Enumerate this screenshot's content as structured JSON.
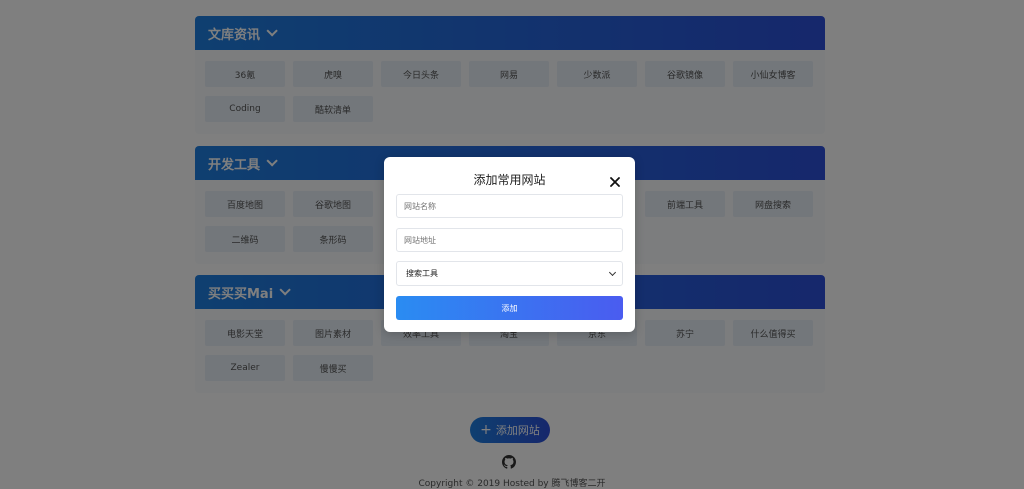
{
  "sections": [
    {
      "title": "文库资讯",
      "items": [
        "36氪",
        "虎嗅",
        "今日头条",
        "网易",
        "少数派",
        "谷歌镜像",
        "小仙女博客",
        "Coding",
        "酷软清单"
      ]
    },
    {
      "title": "开发工具",
      "items": [
        "百度地图",
        "谷歌地图",
        "",
        "",
        "",
        "前端工具",
        "网盘搜索",
        "二维码",
        "条形码"
      ]
    },
    {
      "title": "买买买Mai",
      "items": [
        "电影天堂",
        "图片素材",
        "效率工具",
        "淘宝",
        "京东",
        "苏宁",
        "什么值得买",
        "Zealer",
        "慢慢买"
      ]
    }
  ],
  "add_site_label": "添加网站",
  "footer_text": "Copyright © 2019 Hosted by 腾飞博客二开",
  "modal": {
    "title": "添加常用网站",
    "name_placeholder": "网站名称",
    "url_placeholder": "网站地址",
    "category_value": "搜索工具",
    "submit_label": "添加"
  },
  "colors": {
    "accent_start": "#1e7fe0",
    "accent_end": "#2c4fd8",
    "overlay": "rgba(0,0,0,0.5)"
  }
}
